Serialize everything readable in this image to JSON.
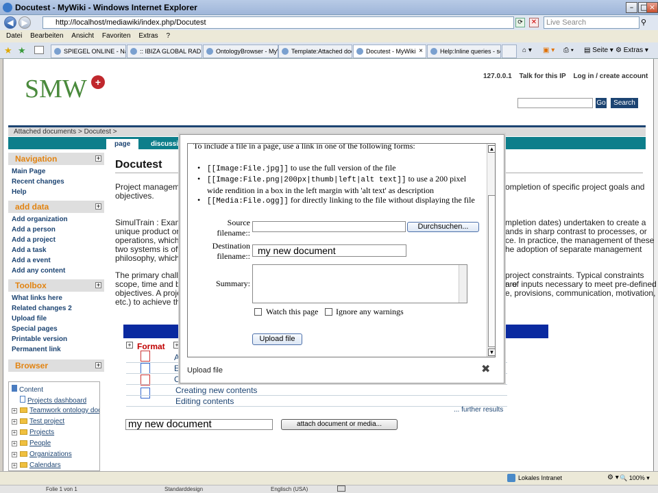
{
  "window": {
    "title": "Docutest - MyWiki - Windows Internet Explorer"
  },
  "addressbar": {
    "url": "http://localhost/mediawiki/index.php/Docutest",
    "search_placeholder": "Live Search"
  },
  "menu": {
    "items": [
      "Datei",
      "Bearbeiten",
      "Ansicht",
      "Favoriten",
      "Extras",
      "?"
    ]
  },
  "browser_tabs": [
    {
      "label": "SPIEGEL ONLINE - Nach..."
    },
    {
      "label": ":: IBIZA GLOBAL RADIO..."
    },
    {
      "label": "OntologyBrowser - MyWiki"
    },
    {
      "label": "Template:Attached doc..."
    },
    {
      "label": "Docutest - MyWiki"
    },
    {
      "label": "Help:Inline queries - se..."
    }
  ],
  "browser_tools": {
    "seite": "Seite",
    "extras": "Extras"
  },
  "wiki": {
    "logo": "SMW",
    "logo_plus": "+",
    "top_links": [
      "127.0.0.1",
      "Talk for this IP",
      "Log in / create account"
    ],
    "go_button": "Go",
    "search_button": "Search",
    "breadcrumb": "Attached documents >  Docutest >",
    "tabs": [
      "page",
      "discussion"
    ]
  },
  "sidebar": {
    "navigation": {
      "title": "Navigation",
      "links": [
        "Main Page",
        "Recent changes",
        "Help"
      ]
    },
    "add_data": {
      "title": "add data",
      "links": [
        "Add organization",
        "Add a person",
        "Add a project",
        "Add a task",
        "Add a event",
        "Add any content"
      ]
    },
    "toolbox": {
      "title": "Toolbox",
      "links": [
        "What links here",
        "Related changes 2",
        "Upload file",
        "Special pages",
        "Printable version",
        "Permanent link"
      ]
    },
    "browser": {
      "title": "Browser",
      "tree": [
        "Content",
        "Projects dashboard",
        "Teamwork ontology docu",
        "Test project",
        "Projects",
        "People",
        "Organizations",
        "Calendars"
      ]
    }
  },
  "article": {
    "title": "Docutest",
    "p1a": "Project manageme",
    "p1b": "ompletion of specific project goals and",
    "p1c": "objectives.",
    "p2a": "SimulTrain : Examp",
    "p2b": "mpletion dates) undertaken to create a",
    "p2c": "unique product or s",
    "p2d": "ands in sharp contrast to processes, or",
    "p2e": "operations, which a",
    "p2f": "ce. In practice, the management of these",
    "p2g": "two systems is ofte",
    "p2h": "he adoption of separate management",
    "p2i": "philosophy, which is",
    "p3a": "The primary challer",
    "p3b": "project constraints. Typical constraints are",
    "p3c": "scope, time and bu",
    "p3d": "n of inputs necessary to meet pre-defined",
    "p3e": "objectives. A projec",
    "p3f": "e, provisions, communication, motivation,",
    "p3g": "etc.) to achieve the"
  },
  "doc_table": {
    "format_header": "Format",
    "rows": [
      "A",
      "E",
      "C",
      "Creating new contents",
      "Editing contents"
    ],
    "further": "... further results"
  },
  "attach": {
    "input_value": "my new document",
    "button": "attach document or media..."
  },
  "dialog": {
    "intro": "To include a file in a page, use a link in one of the following forms:",
    "items": [
      {
        "code": "[[Image:File.jpg]]",
        "text": "to use the full version of the file"
      },
      {
        "code": "[[Image:File.png|200px|thumb|left|alt text]]",
        "text": "to use a 200 pixel",
        "text2": "wide rendition in a box in the left margin with 'alt text' as description"
      },
      {
        "code": "[[Media:File.ogg]]",
        "text": "for directly linking to the file without displaying the file"
      }
    ],
    "source_label_1": "Source",
    "source_label_2": "filename::",
    "browse_button": "Durchsuchen...",
    "dest_label_1": "Destination",
    "dest_label_2": "filename::",
    "dest_value": "my new document",
    "summary_label": "Summary:",
    "watch_label": "Watch this page",
    "ignore_label": "Ignore any warnings",
    "upload_button": "Upload file",
    "footer_title": "Upload file"
  },
  "status": {
    "zone": "Lokales Intranet",
    "zoom": "100%"
  },
  "bottom": {
    "page": "Folie 1 von 1",
    "design": "Standarddesign",
    "lang": "Englisch (USA)"
  }
}
